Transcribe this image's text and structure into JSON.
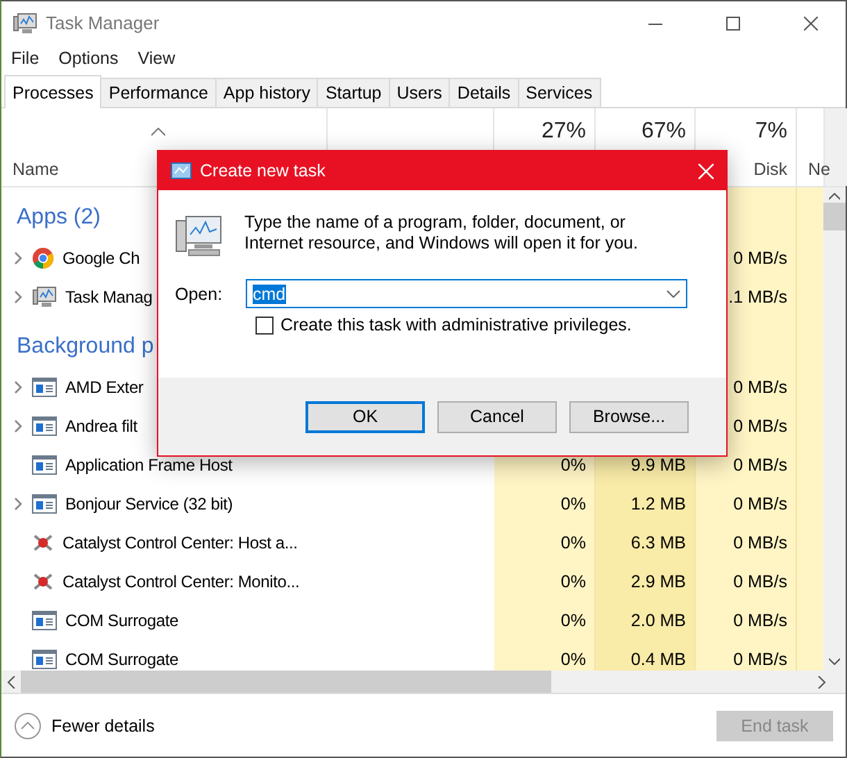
{
  "window": {
    "title": "Task Manager"
  },
  "menu": [
    "File",
    "Options",
    "View"
  ],
  "tabs": [
    {
      "label": "Processes",
      "selected": true
    },
    {
      "label": "Performance",
      "selected": false
    },
    {
      "label": "App history",
      "selected": false
    },
    {
      "label": "Startup",
      "selected": false
    },
    {
      "label": "Users",
      "selected": false
    },
    {
      "label": "Details",
      "selected": false
    },
    {
      "label": "Services",
      "selected": false
    }
  ],
  "columns": [
    {
      "label": "Name"
    },
    {
      "usage": "27%"
    },
    {
      "usage": "67%"
    },
    {
      "usage": "7%",
      "label": "Disk"
    },
    {
      "label": "Ne"
    }
  ],
  "rows": [
    {
      "kind": "group",
      "name": "Apps (2)"
    },
    {
      "kind": "chrome",
      "name": "Google Ch",
      "expanded": false,
      "disk": "0 MB/s"
    },
    {
      "kind": "monitor",
      "name": "Task Manag",
      "expanded": false,
      "disk": ".1 MB/s"
    },
    {
      "kind": "group",
      "name": "Background p"
    },
    {
      "kind": "service",
      "name": "AMD Exter",
      "expanded": false,
      "disk": "0 MB/s"
    },
    {
      "kind": "service",
      "name": "Andrea filt",
      "expanded": false,
      "disk": "0 MB/s"
    },
    {
      "kind": "service",
      "name": "Application Frame Host",
      "cpu": "0%",
      "memory": "9.9 MB",
      "disk": "0 MB/s"
    },
    {
      "kind": "service",
      "name": "Bonjour Service (32 bit)",
      "expanded": false,
      "cpu": "0%",
      "memory": "1.2 MB",
      "disk": "0 MB/s"
    },
    {
      "kind": "catalyst",
      "name": "Catalyst Control Center: Host a...",
      "cpu": "0%",
      "memory": "6.3 MB",
      "disk": "0 MB/s"
    },
    {
      "kind": "catalyst",
      "name": "Catalyst Control Center: Monito...",
      "cpu": "0%",
      "memory": "2.9 MB",
      "disk": "0 MB/s"
    },
    {
      "kind": "service",
      "name": "COM Surrogate",
      "cpu": "0%",
      "memory": "2.0 MB",
      "disk": "0 MB/s"
    },
    {
      "kind": "service",
      "name": "COM Surrogate",
      "cpu": "0%",
      "memory": "0.4 MB",
      "disk": "0 MB/s"
    }
  ],
  "footer": {
    "details_link": "Fewer details",
    "end_task": {
      "label": "End task",
      "disabled": true
    }
  },
  "dialog": {
    "title": "Create new task",
    "message": "Type the name of a program, folder, document, or Internet resource, and Windows will open it for you.",
    "open_label": "Open:",
    "value": "cmd",
    "admin_checkbox": {
      "label": "Create this task with administrative privileges.",
      "checked": false
    },
    "buttons": [
      {
        "label": "OK",
        "default": true
      },
      {
        "label": "Cancel",
        "default": false
      },
      {
        "label": "Browse...",
        "default": false
      }
    ]
  }
}
